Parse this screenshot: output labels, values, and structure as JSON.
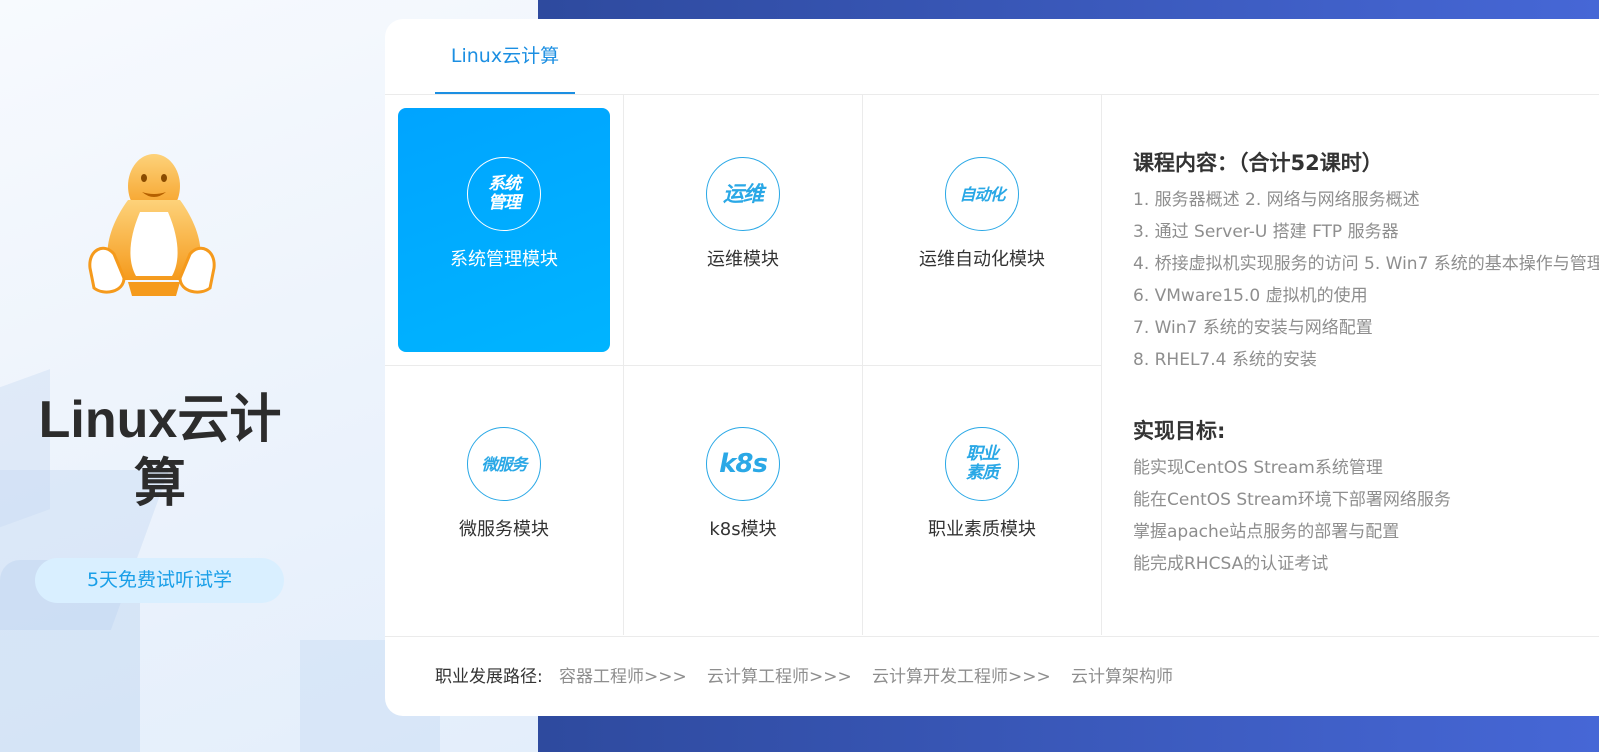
{
  "side": {
    "title_line1": "Linux云计",
    "title_line2": "算",
    "trial_button": "5天免费试听试学"
  },
  "tab": {
    "label": "Linux云计算"
  },
  "modules": [
    {
      "label": "系统管理模块",
      "icon_text_1": "系统",
      "icon_text_2": "管理",
      "active": true
    },
    {
      "label": "运维模块",
      "icon_text_1": "运维",
      "icon_text_2": "",
      "active": false
    },
    {
      "label": "运维自动化模块",
      "icon_text_1": "自动化",
      "icon_text_2": "",
      "active": false
    },
    {
      "label": "微服务模块",
      "icon_text_1": "微服务",
      "icon_text_2": "",
      "active": false
    },
    {
      "label": "k8s模块",
      "icon_text_1": "k8s",
      "icon_text_2": "",
      "active": false
    },
    {
      "label": "职业素质模块",
      "icon_text_1": "职业",
      "icon_text_2": "素质",
      "active": false
    }
  ],
  "course": {
    "title": "课程内容：（合计52课时）",
    "items": [
      "1. 服务器概述 2. 网络与网络服务概述",
      "3. 通过 Server-U 搭建 FTP 服务器",
      "4. 桥接虚拟机实现服务的访问 5. Win7 系统的基本操作与管理",
      "6. VMware15.0 虚拟机的使用",
      "7. Win7 系统的安装与网络配置",
      "8. RHEL7.4 系统的安装"
    ]
  },
  "goals": {
    "title": "实现目标:",
    "items": [
      "能实现CentOS Stream系统管理",
      "能在CentOS Stream环境下部署网络服务",
      "掌握apache站点服务的部署与配置",
      "能完成RHCSA的认证考试"
    ]
  },
  "career": {
    "label": "职业发展路径:",
    "paths": [
      "容器工程师>>>",
      "云计算工程师>>>",
      "云计算开发工程师>>>",
      "云计算架构师"
    ]
  },
  "colors": {
    "accent": "#1c8fe2",
    "active_tile": "#00a4ff",
    "band": "#3b57c0",
    "penguin": "#f7a32e"
  },
  "icons": {
    "mascot": "penguin-icon"
  }
}
